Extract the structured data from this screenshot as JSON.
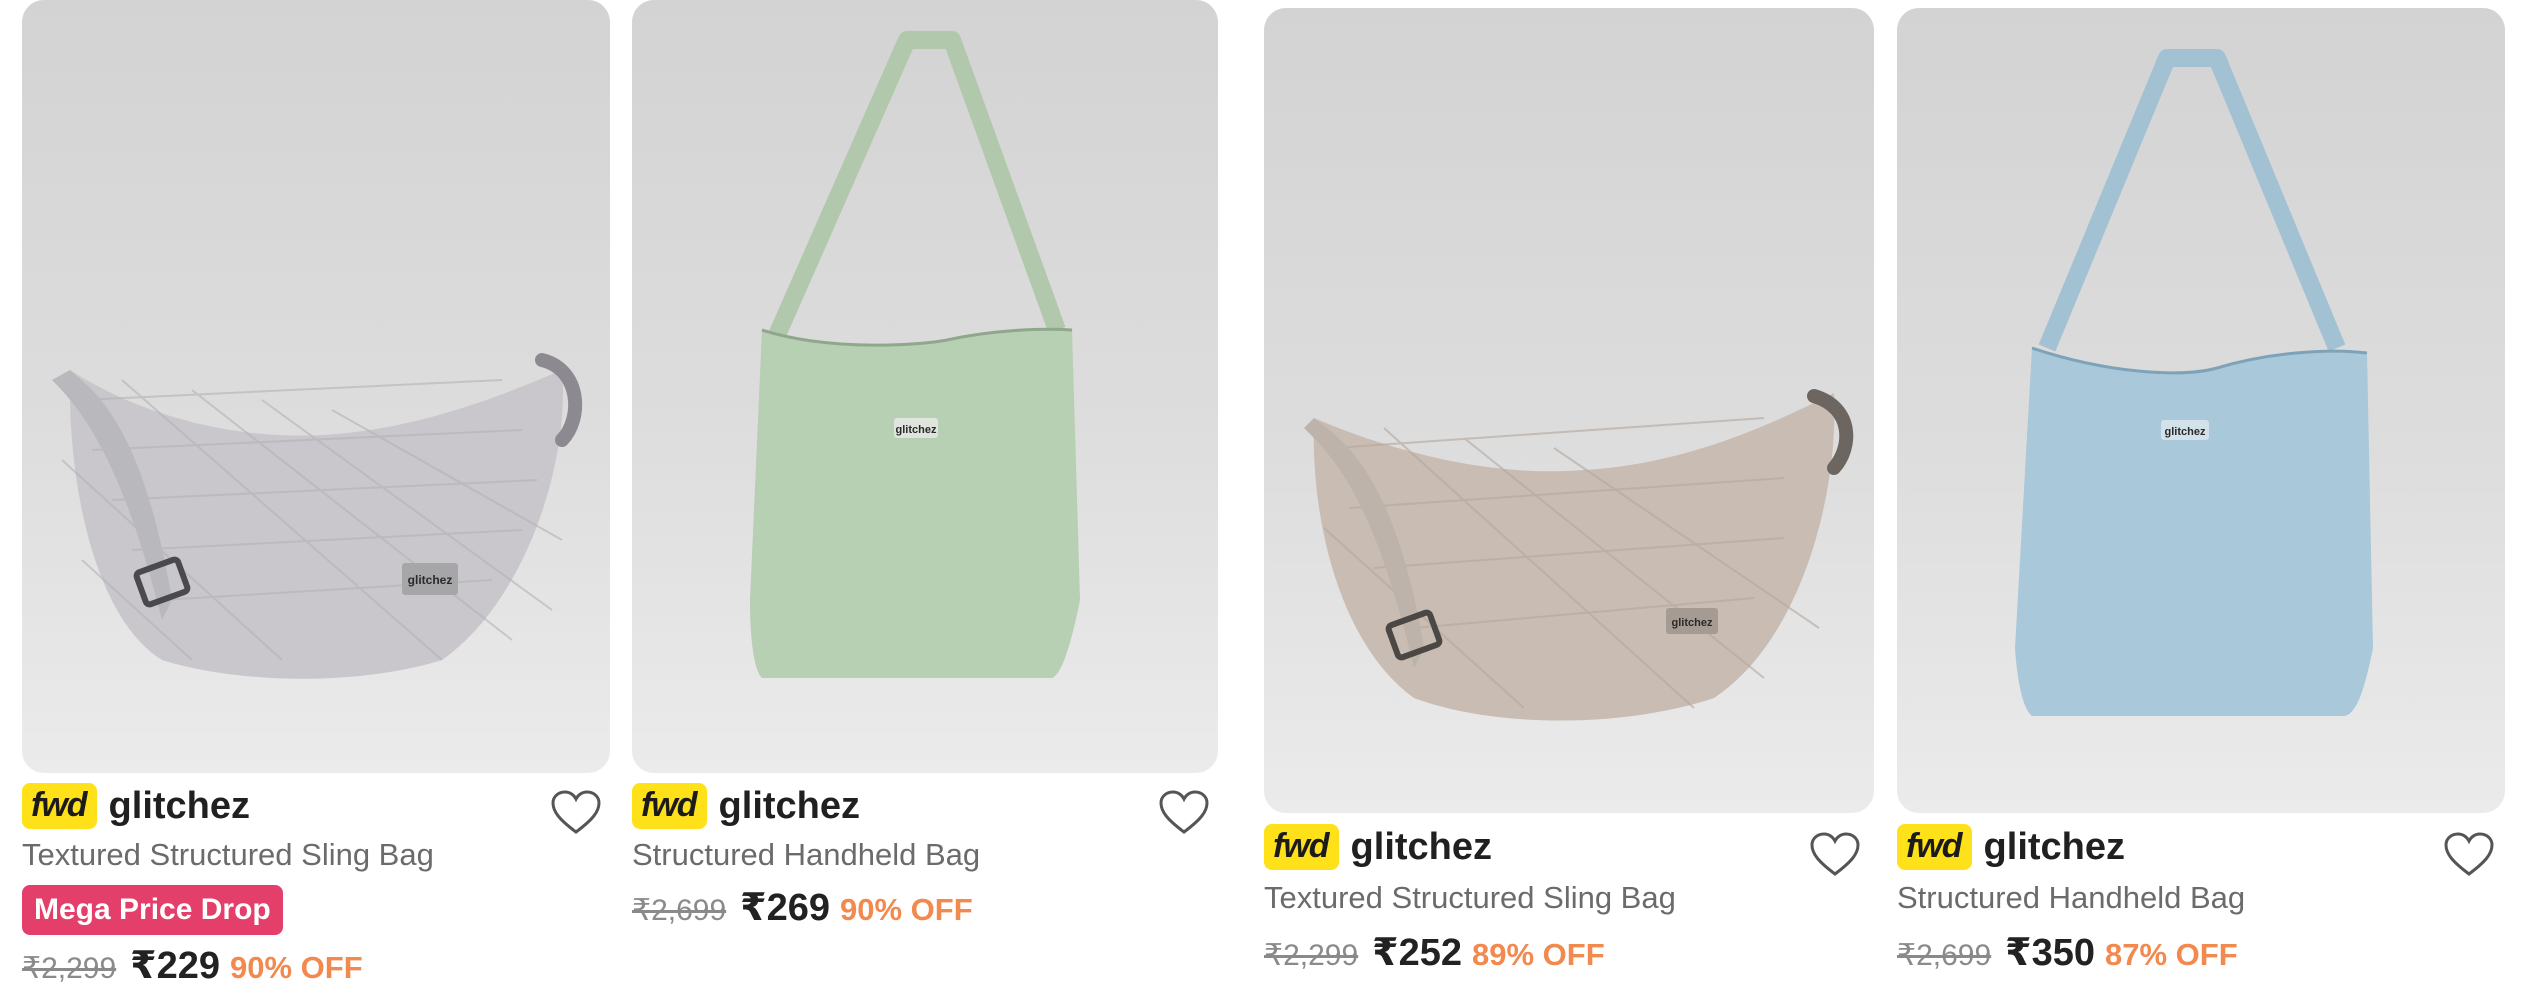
{
  "products": [
    {
      "fwd_label": "fwd",
      "brand": "glitchez",
      "title": "Textured Structured Sling Bag",
      "badge": "Mega Price Drop",
      "mrp": "₹2,299",
      "price": "₹229",
      "discount": "90% OFF",
      "bag_type": "sling",
      "bag_color": "#c9c7cb",
      "logo_text": "glitchez"
    },
    {
      "fwd_label": "fwd",
      "brand": "glitchez",
      "title": "Structured Handheld Bag",
      "mrp": "₹2,699",
      "price": "₹269",
      "discount": "90% OFF",
      "bag_type": "tote",
      "bag_color": "#b7cfb2",
      "logo_text": "glitchez"
    },
    {
      "fwd_label": "fwd",
      "brand": "glitchez",
      "title": "Textured Structured Sling Bag",
      "mrp": "₹2,299",
      "price": "₹252",
      "discount": "89% OFF",
      "bag_type": "sling",
      "bag_color": "#c8bcb3",
      "logo_text": "glitchez"
    },
    {
      "fwd_label": "fwd",
      "brand": "glitchez",
      "title": "Structured Handheld Bag",
      "mrp": "₹2,699",
      "price": "₹350",
      "discount": "87% OFF",
      "bag_type": "tote",
      "bag_color": "#a9c8da",
      "logo_text": "glitchez"
    }
  ],
  "icons": {
    "wishlist": "heart-outline-icon"
  },
  "colors": {
    "fwd_badge": "#ffe11a",
    "mega_badge": "#e43e6a",
    "discount": "#f2894e"
  }
}
